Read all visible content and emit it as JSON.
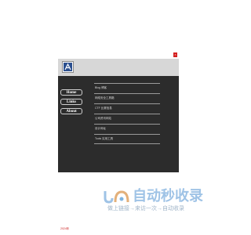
{
  "window": {
    "close_glyph": "×"
  },
  "header": {
    "logo_icon": "lizard-logo-icon"
  },
  "nav": {
    "items": [
      {
        "label": "Home"
      },
      {
        "label": "Links"
      },
      {
        "label": "About"
      }
    ]
  },
  "links": [
    {
      "label": "Blog 博客"
    },
    {
      "label": "网络安全工具箱"
    },
    {
      "label": "CTF 比赛信息"
    },
    {
      "label": "公司资讯网站"
    },
    {
      "label": "设计网址"
    },
    {
      "label": "Tools 实用工具"
    }
  ],
  "brand": {
    "title": "自动秒收录",
    "subtitle": "做上链接→来访一次→自动收录"
  },
  "footer": {
    "text": "2024年"
  },
  "colors": {
    "accent_red": "#d42020",
    "content_bg": "#2c2c2c",
    "header_bg": "#d7d7d7",
    "brand_blue": "#9fc3e6"
  }
}
